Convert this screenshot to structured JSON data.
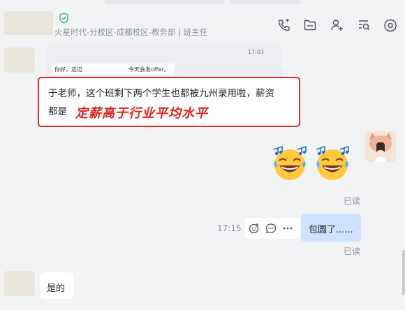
{
  "header": {
    "org_text": "火星时代-分校区-成都校区-教务部 | 班主任",
    "icons": [
      "call-icon",
      "folder-icon",
      "add-user-icon",
      "search-list-icon",
      "settings-icon"
    ]
  },
  "quoted_screenshot": {
    "time": "17:03",
    "text_left": "你好，这边",
    "text_right": "今天会发offer。"
  },
  "highlight_message": {
    "line1": "于老师，这个班剩下两个学生也都被九州录用啦，薪资",
    "line2_prefix": "都是",
    "emphasis": "定薪高于行业平均水平"
  },
  "status": {
    "read1": "已读",
    "read2": "已读"
  },
  "outgoing": {
    "time": "17:15",
    "text": "包圆了......"
  },
  "incoming": {
    "text": "是的"
  },
  "colors": {
    "accent_red": "#d9302a",
    "bubble_blue": "#cde2ff",
    "shield_green": "#3db37a"
  }
}
